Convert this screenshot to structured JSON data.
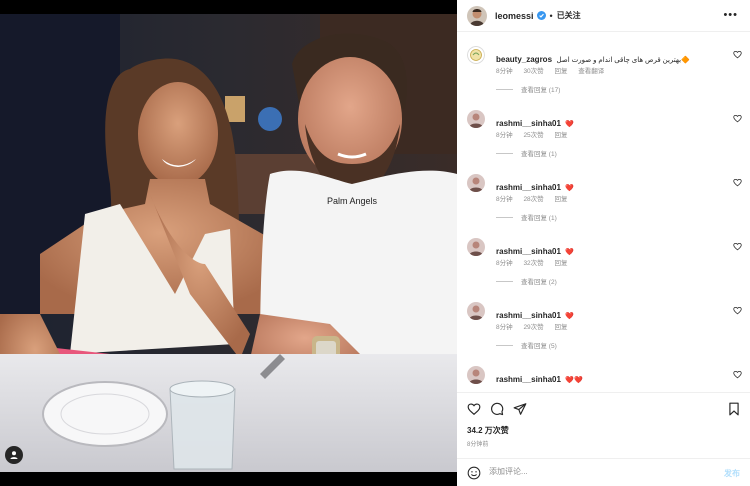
{
  "post": {
    "username": "leomessi",
    "follow_state": "已关注",
    "more_label": "•••",
    "likes": "34.2 万次赞",
    "time": "8分钟前",
    "photo_label": "Photo of a woman in a white top and a man in a white t-shirt at a restaurant table",
    "shirt_text": "Palm Angels"
  },
  "comments": [
    {
      "username": "beauty_zagros",
      "text": "بهترین قرص های چاقی اندام و صورت اصل🔶",
      "time": "8分钟",
      "likes": "30次赞",
      "reply": "回复",
      "translate": "查看翻译",
      "view_replies": "查看回复 (17)"
    },
    {
      "username": "rashmi__sinha01",
      "text": "❤️",
      "time": "8分钟",
      "likes": "25次赞",
      "reply": "回复",
      "view_replies": "查看回复 (1)"
    },
    {
      "username": "rashmi__sinha01",
      "text": "❤️",
      "time": "8分钟",
      "likes": "28次赞",
      "reply": "回复",
      "view_replies": "查看回复 (1)"
    },
    {
      "username": "rashmi__sinha01",
      "text": "❤️",
      "time": "8分钟",
      "likes": "32次赞",
      "reply": "回复",
      "view_replies": "查看回复 (2)"
    },
    {
      "username": "rashmi__sinha01",
      "text": "❤️",
      "time": "8分钟",
      "likes": "29次赞",
      "reply": "回复",
      "view_replies": "查看回复 (5)"
    },
    {
      "username": "rashmi__sinha01",
      "text": "❤️❤️",
      "time": "",
      "likes": "",
      "reply": "",
      "view_replies": ""
    }
  ],
  "add_comment": {
    "placeholder": "添加评论...",
    "post_label": "发布"
  },
  "colors": {
    "accent": "#0095f6",
    "heart": "#ed4956",
    "muted": "#8e8e8e",
    "text": "#262626"
  }
}
